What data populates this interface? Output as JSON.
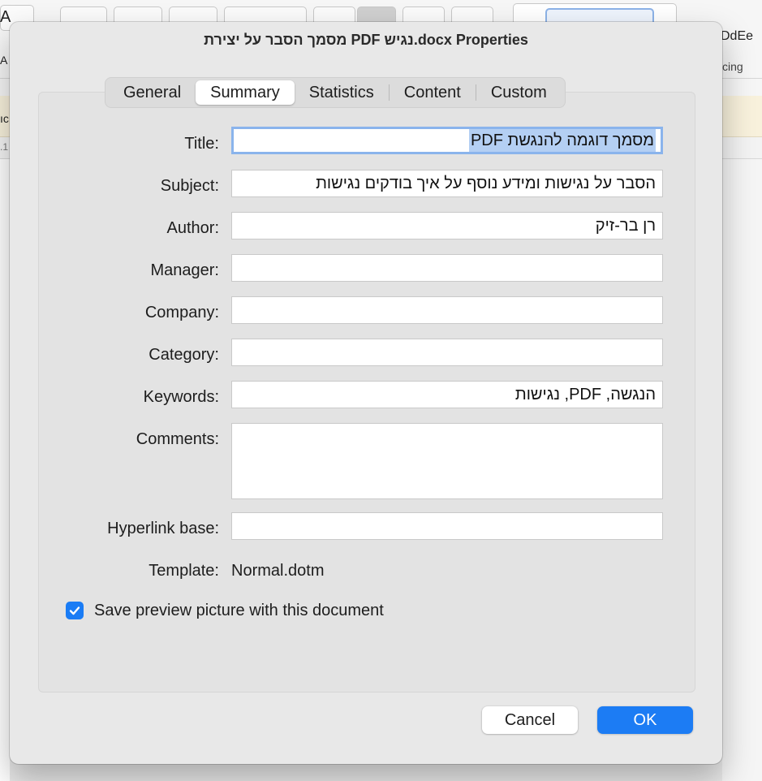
{
  "background": {
    "style_preview_text": "DdEe",
    "spacing_text": "cing",
    "left_fragments": [
      "A",
      "A",
      "ıc",
      ".1"
    ]
  },
  "dialog": {
    "title": "מסמך הסבר על יצירת PDF נגיש.docx Properties",
    "tabs": [
      {
        "label": "General",
        "active": false
      },
      {
        "label": "Summary",
        "active": true
      },
      {
        "label": "Statistics",
        "active": false
      },
      {
        "label": "Content",
        "active": false
      },
      {
        "label": "Custom",
        "active": false
      }
    ],
    "fields": {
      "title": {
        "label": "Title:",
        "value": "מסמך דוגמה להנגשת PDF"
      },
      "subject": {
        "label": "Subject:",
        "value": "הסבר על נגישות ומידע נוסף על איך בודקים נגישות"
      },
      "author": {
        "label": "Author:",
        "value": "רן בר-זיק"
      },
      "manager": {
        "label": "Manager:",
        "value": ""
      },
      "company": {
        "label": "Company:",
        "value": ""
      },
      "category": {
        "label": "Category:",
        "value": ""
      },
      "keywords": {
        "label": "Keywords:",
        "value": "הנגשה, PDF, נגישות"
      },
      "comments": {
        "label": "Comments:",
        "value": ""
      },
      "hyperlink_base": {
        "label": "Hyperlink base:",
        "value": ""
      }
    },
    "template": {
      "label": "Template:",
      "value": "Normal.dotm"
    },
    "save_preview": {
      "label": "Save preview picture with this document",
      "checked": true
    },
    "buttons": {
      "cancel": "Cancel",
      "ok": "OK"
    },
    "colors": {
      "accent": "#1c7cf4",
      "focus_ring": "#8ab4ec",
      "selection": "#b4cff3"
    }
  }
}
